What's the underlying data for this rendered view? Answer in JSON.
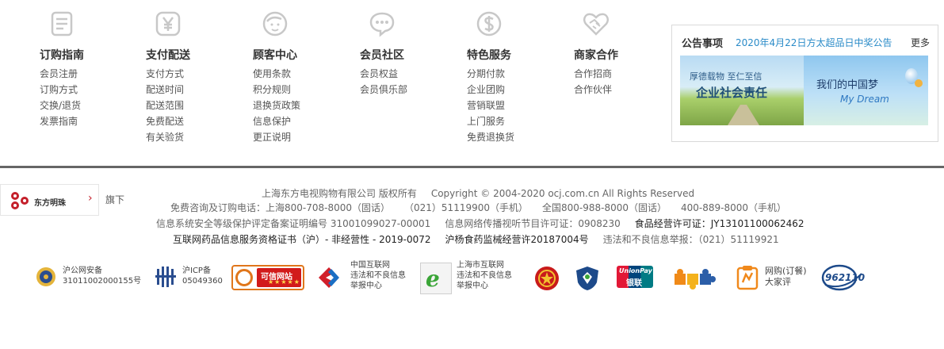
{
  "nav_columns": [
    {
      "title": "订购指南",
      "icon": "memo-icon",
      "links": [
        "会员注册",
        "订购方式",
        "交换/退货",
        "发票指南"
      ]
    },
    {
      "title": "支付配送",
      "icon": "yen-icon",
      "links": [
        "支付方式",
        "配送时间",
        "配送范围",
        "免费配送",
        "有关验货"
      ]
    },
    {
      "title": "顾客中心",
      "icon": "face-icon",
      "links": [
        "使用条款",
        "积分规则",
        "退换货政策",
        "信息保护",
        "更正说明"
      ]
    },
    {
      "title": "会员社区",
      "icon": "chat-icon",
      "links": [
        "会员权益",
        "会员俱乐部"
      ]
    },
    {
      "title": "特色服务",
      "icon": "dollar-icon",
      "links": [
        "分期付款",
        "企业团购",
        "营销联盟",
        "上门服务",
        "免费退换货"
      ]
    },
    {
      "title": "商家合作",
      "icon": "handshake-icon",
      "links": [
        "合作招商",
        "合作伙伴"
      ]
    }
  ],
  "notice": {
    "title": "公告事项",
    "headline": "2020年4月22日方太超品日中奖公告",
    "more": "更多",
    "banner1": {
      "line1": "厚德载物  至仁至信",
      "line2": "企业社会责任"
    },
    "banner2": {
      "line1": "我们的中国梦",
      "line2": "My Dream"
    }
  },
  "footer": {
    "brand_name": "东方明珠",
    "subsidiary": "旗下",
    "line1": {
      "company": "上海东方电视购物有限公司 版权所有",
      "copyright": "Copyright © 2004-2020 ocj.com.cn All Rights Reserved"
    },
    "line2": {
      "hotline": "免费咨询及订购电话：上海800-708-8000（固话）",
      "sh_mobile": "（021）51119900（手机）",
      "national": "全国800-988-8000（固话）",
      "national_mobile": "400-889-8000（手机）"
    },
    "line3": {
      "security": "信息系统安全等级保护评定备案证明编号 31001099027-00001",
      "av_license": "信息网络传播视听节目许可证：0908230",
      "food_license": "食品经营许可证：JY13101100062462"
    },
    "line4": {
      "drug_cert": "互联网药品信息服务资格证书（沪）- 非经营性 - 2019-0072",
      "medical": "沪杨食药监械经营许20187004号",
      "report": "违法和不良信息举报：（021）51119921"
    }
  },
  "badges": [
    {
      "icon": "police-badge-icon",
      "line1": "沪公网安备",
      "line2": "31011002000155号"
    },
    {
      "icon": "icp-icon",
      "line1": "沪ICP备",
      "line2": "05049360"
    },
    {
      "icon": "trusted-site-icon",
      "line1": "可信网站"
    },
    {
      "icon": "internet-report-icon",
      "line1": "中国互联网",
      "line2": "违法和不良信息",
      "line3": "举报中心"
    },
    {
      "icon": "shanghai-report-icon",
      "line1": "上海市互联网",
      "line2": "违法和不良信息",
      "line3": "举报中心"
    },
    {
      "icon": "emblem-icon"
    },
    {
      "icon": "shield-icon"
    },
    {
      "icon": "unionpay-icon",
      "line1": "UnionPay",
      "line2": "银联"
    },
    {
      "icon": "puzzle-icon"
    },
    {
      "icon": "review-icon",
      "line1": "网购(订餐)",
      "line2": "大家评"
    },
    {
      "icon": "hotline-icon",
      "line1": "962110"
    }
  ],
  "colors": {
    "accent_blue": "#2a8bc8",
    "brand_red": "#c41f2a",
    "divider": "#666666"
  }
}
